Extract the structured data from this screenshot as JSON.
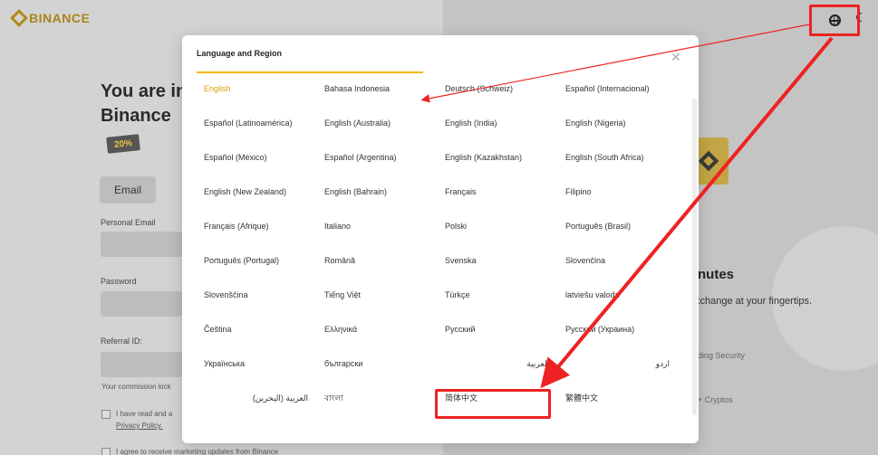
{
  "background": {
    "brand": "BINANCE",
    "headline_line1": "You are in",
    "headline_line2": "Binance",
    "promo_badge": "20%",
    "tab_email": "Email",
    "personal_email_label": "Personal Email",
    "password_label": "Password",
    "referral_label": "Referral ID:",
    "commission_text": "Your commission kick",
    "terms_text": "I have read and a",
    "privacy_text": "Privacy Policy.",
    "marketing_text": "I agree to receive marketing updates from Binance",
    "right_title": "nutes",
    "right_subtitle": "xchange at your fingertips.",
    "right_feature_1": "ding Security",
    "right_feature_2": "+ Cryptos"
  },
  "modal": {
    "title": "Language and Region",
    "close_icon": "close-icon",
    "languages": [
      "English",
      "Bahasa Indonesia",
      "Deutsch (Schweiz)",
      "Español (Internacional)",
      "Español (Latinoamérica)",
      "English (Australia)",
      "English (India)",
      "English (Nigeria)",
      "Español (México)",
      "Español (Argentina)",
      "English (Kazakhstan)",
      "English (South Africa)",
      "English (New Zealand)",
      "English (Bahrain)",
      "Français",
      "Filipino",
      "Français (Afrique)",
      "Italiano",
      "Polski",
      "Português (Brasil)",
      "Português (Portugal)",
      "Română",
      "Svenska",
      "Slovenčina",
      "Slovenščina",
      "Tiếng Việt",
      "Türkçe",
      "latviešu valoda",
      "Čeština",
      "Ελληνικά",
      "Русский",
      "Русский (Украина)",
      "Українська",
      "български",
      "العربية",
      "اردو",
      "العربية (البحرين)",
      "বাংলা",
      "简体中文",
      "繁體中文"
    ],
    "selected_language": "English"
  },
  "annotations": {
    "color": "#ee2222",
    "highlighted_target": "简体中文"
  }
}
